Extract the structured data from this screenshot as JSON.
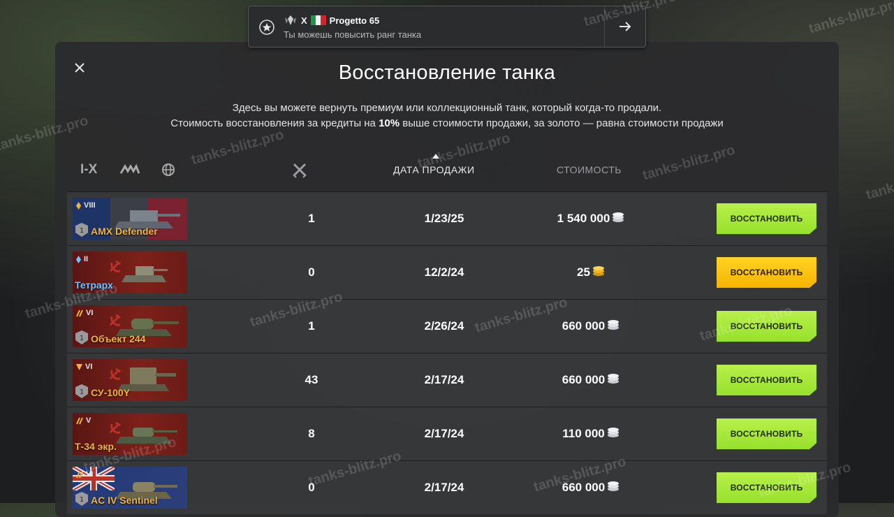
{
  "notification": {
    "tier": "X",
    "tank_name": "Progetto 65",
    "message": "Ты можешь повысить ранг танка"
  },
  "panel": {
    "title": "Восстановление танка",
    "description_line1": "Здесь вы можете вернуть премиум или коллекционный танк, который когда-то продали.",
    "description_line2_prefix": "Стоимость восстановления за кредиты на ",
    "description_line2_bold": "10%",
    "description_line2_suffix": " выше стоимости продажи, за золото — равна стоимости продажи"
  },
  "filters": {
    "tier_label": "I-X"
  },
  "columns": {
    "sale_date": "ДАТА ПРОДАЖИ",
    "cost": "СТОИМОСТЬ"
  },
  "rows": [
    {
      "tier": "VIII",
      "name": "AMX Defender",
      "battles": "1",
      "date": "1/23/25",
      "price": "1 540 000",
      "currency": "credits",
      "button": "ВОССТАНОВИТЬ"
    },
    {
      "tier": "II",
      "name": "Тетрарх",
      "battles": "0",
      "date": "12/2/24",
      "price": "25",
      "currency": "gold",
      "button": "ВОССТАНОВИТЬ"
    },
    {
      "tier": "VI",
      "name": "Объект 244",
      "battles": "1",
      "date": "2/26/24",
      "price": "660 000",
      "currency": "credits",
      "button": "ВОССТАНОВИТЬ"
    },
    {
      "tier": "VI",
      "name": "СУ-100Y",
      "battles": "43",
      "date": "2/17/24",
      "price": "660 000",
      "currency": "credits",
      "button": "ВОССТАНОВИТЬ"
    },
    {
      "tier": "V",
      "name": "Т-34 экр.",
      "battles": "8",
      "date": "2/17/24",
      "price": "110 000",
      "currency": "credits",
      "button": "ВОССТАНОВИТЬ"
    },
    {
      "tier": "VI",
      "name": "AC IV Sentinel",
      "battles": "0",
      "date": "2/17/24",
      "price": "660 000",
      "currency": "credits",
      "button": "ВОССТАНОВИТЬ"
    }
  ],
  "watermark": "tanks-blitz.pro",
  "colors": {
    "restore_credits": "#a8e83a",
    "restore_gold": "#f9c20f",
    "tank_name": "#f2b53a",
    "tank_name_collector": "#6fc3ff"
  }
}
